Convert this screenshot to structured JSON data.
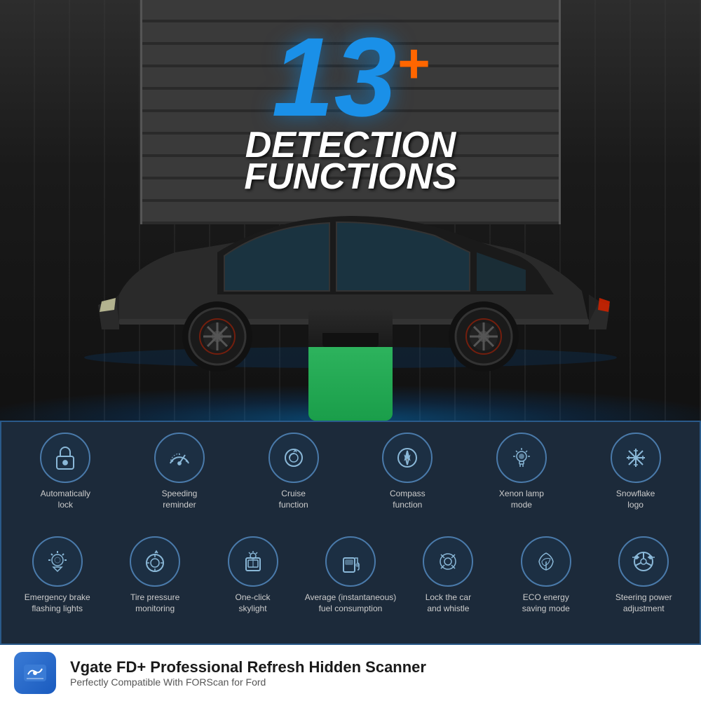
{
  "hero": {
    "number": "13",
    "plus": "+",
    "line1": "DETECTION",
    "line2": "FUNCTIONS"
  },
  "features": {
    "row1": [
      {
        "id": "automatically-lock",
        "label": "Automatically\nlock",
        "icon": "lock"
      },
      {
        "id": "speeding-reminder",
        "label": "Speeding\nreminder",
        "icon": "speedometer"
      },
      {
        "id": "cruise-function",
        "label": "Cruise\nfunction",
        "icon": "cruise"
      },
      {
        "id": "compass-function",
        "label": "Compass\nfunction",
        "icon": "compass"
      },
      {
        "id": "xenon-lamp",
        "label": "Xenon lamp\nmode",
        "icon": "lamp"
      },
      {
        "id": "snowflake-logo",
        "label": "Snowflake\nlogo",
        "icon": "snowflake"
      }
    ],
    "row2": [
      {
        "id": "emergency-brake",
        "label": "Emergency brake\nflashing lights",
        "icon": "hazard"
      },
      {
        "id": "tire-pressure",
        "label": "Tire pressure\nmonitoring",
        "icon": "tire"
      },
      {
        "id": "one-click-skylight",
        "label": "One-click\nskylight",
        "icon": "skylight"
      },
      {
        "id": "fuel-consumption",
        "label": "Average (instantaneous)\nfuel consumption",
        "icon": "fuel"
      },
      {
        "id": "lock-whistle",
        "label": "Lock the car\nand whistle",
        "icon": "whistle"
      },
      {
        "id": "eco-energy",
        "label": "ECO energy\nsaving mode",
        "icon": "eco"
      },
      {
        "id": "steering-power",
        "label": "Steering power\nadjustment",
        "icon": "steering"
      }
    ]
  },
  "branding": {
    "title": "Vgate FD+ Professional Refresh Hidden Scanner",
    "subtitle": "Perfectly Compatible With FORScan for Ford"
  }
}
